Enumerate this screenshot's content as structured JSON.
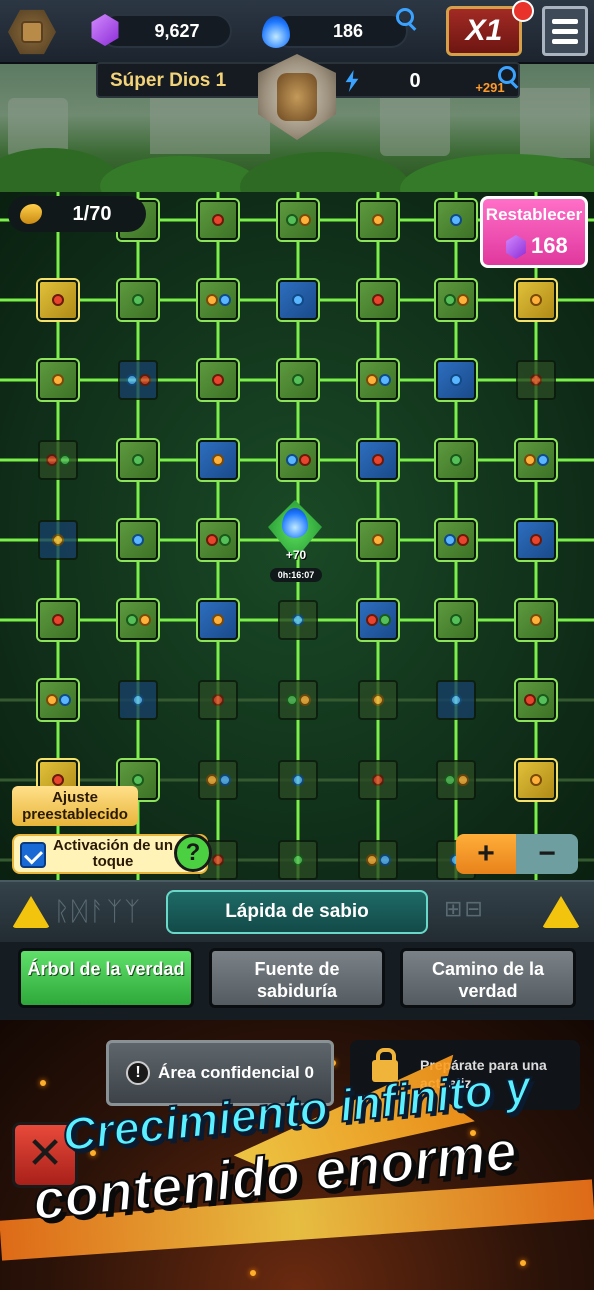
{
  "topbar": {
    "gems": "9,627",
    "flames": "186",
    "speed": "X1"
  },
  "rank": {
    "name": "Súper Dios 1",
    "power": "0",
    "bonus": "+291"
  },
  "tree": {
    "counter": "1/70",
    "reset": {
      "label": "Restablecer",
      "cost": "168"
    },
    "center": {
      "value": "+70",
      "timer": "0h:16:07"
    },
    "preset_label": "Ajuste preestablecido",
    "onetap_label": "Activación de un toque",
    "help_label": "?",
    "plus_label": "+",
    "minus_label": "−"
  },
  "stone": {
    "title": "Lápida de sabio"
  },
  "tabs": [
    {
      "label": "Árbol de la verdad",
      "active": true
    },
    {
      "label": "Fuente de sabiduría",
      "active": false
    },
    {
      "label": "Camino de la verdad",
      "active": false
    }
  ],
  "bottom": {
    "secret_label": "Área confidencial 0",
    "locked_label": "Prepárate para una actualiz...",
    "close_label": "✕"
  },
  "promo": {
    "line1": "Crecimiento infinito y",
    "line2": "contenido enorme"
  }
}
